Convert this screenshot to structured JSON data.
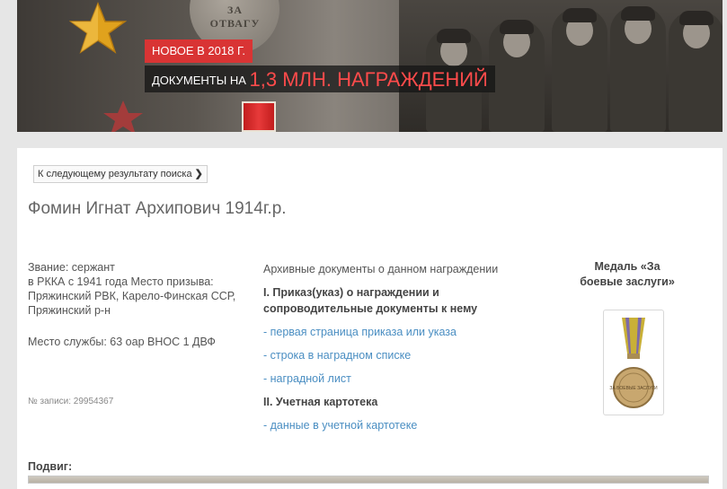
{
  "banner": {
    "medal_inscription": "ЗА ОТВАГУ",
    "new_tag": "НОВОЕ В 2018 Г.",
    "docs_prefix": "ДОКУМЕНТЫ НА",
    "docs_highlight": "1,3 МЛН. НАГРАЖДЕНИЙ"
  },
  "nav": {
    "next_result_label": "К следующему результату поиска",
    "next_icon": "chevron-right-icon"
  },
  "person": {
    "name": "Фомин Игнат Архипович 1914г.р.",
    "rank_line": "Звание: сержант",
    "service_line": "в РККА с 1941 года Место призыва: Пряжинский РВК, Карело-Финская ССР, Пряжинский р-н",
    "unit_line": "Место службы: 63 оар ВНОС 1 ДВФ",
    "record_no": "№ записи: 29954367"
  },
  "archive": {
    "title": "Архивные документы о данном награждении",
    "section1_title": "I. Приказ(указ) о награждении и сопроводительные документы к нему",
    "links1": [
      "- первая страница приказа или указа",
      "- строка в наградном списке",
      "- наградной лист"
    ],
    "section2_title": "II. Учетная картотека",
    "links2": [
      "- данные в учетной картотеке"
    ]
  },
  "award": {
    "title": "Медаль «За боевые заслуги»",
    "medal_inscription": "ЗА БОЕВЫЕ ЗАСЛУГИ"
  },
  "feat": {
    "label": "Подвиг:"
  },
  "colors": {
    "accent_red": "#d93434",
    "link_blue": "#4a8ec2",
    "text_gray": "#555555"
  }
}
